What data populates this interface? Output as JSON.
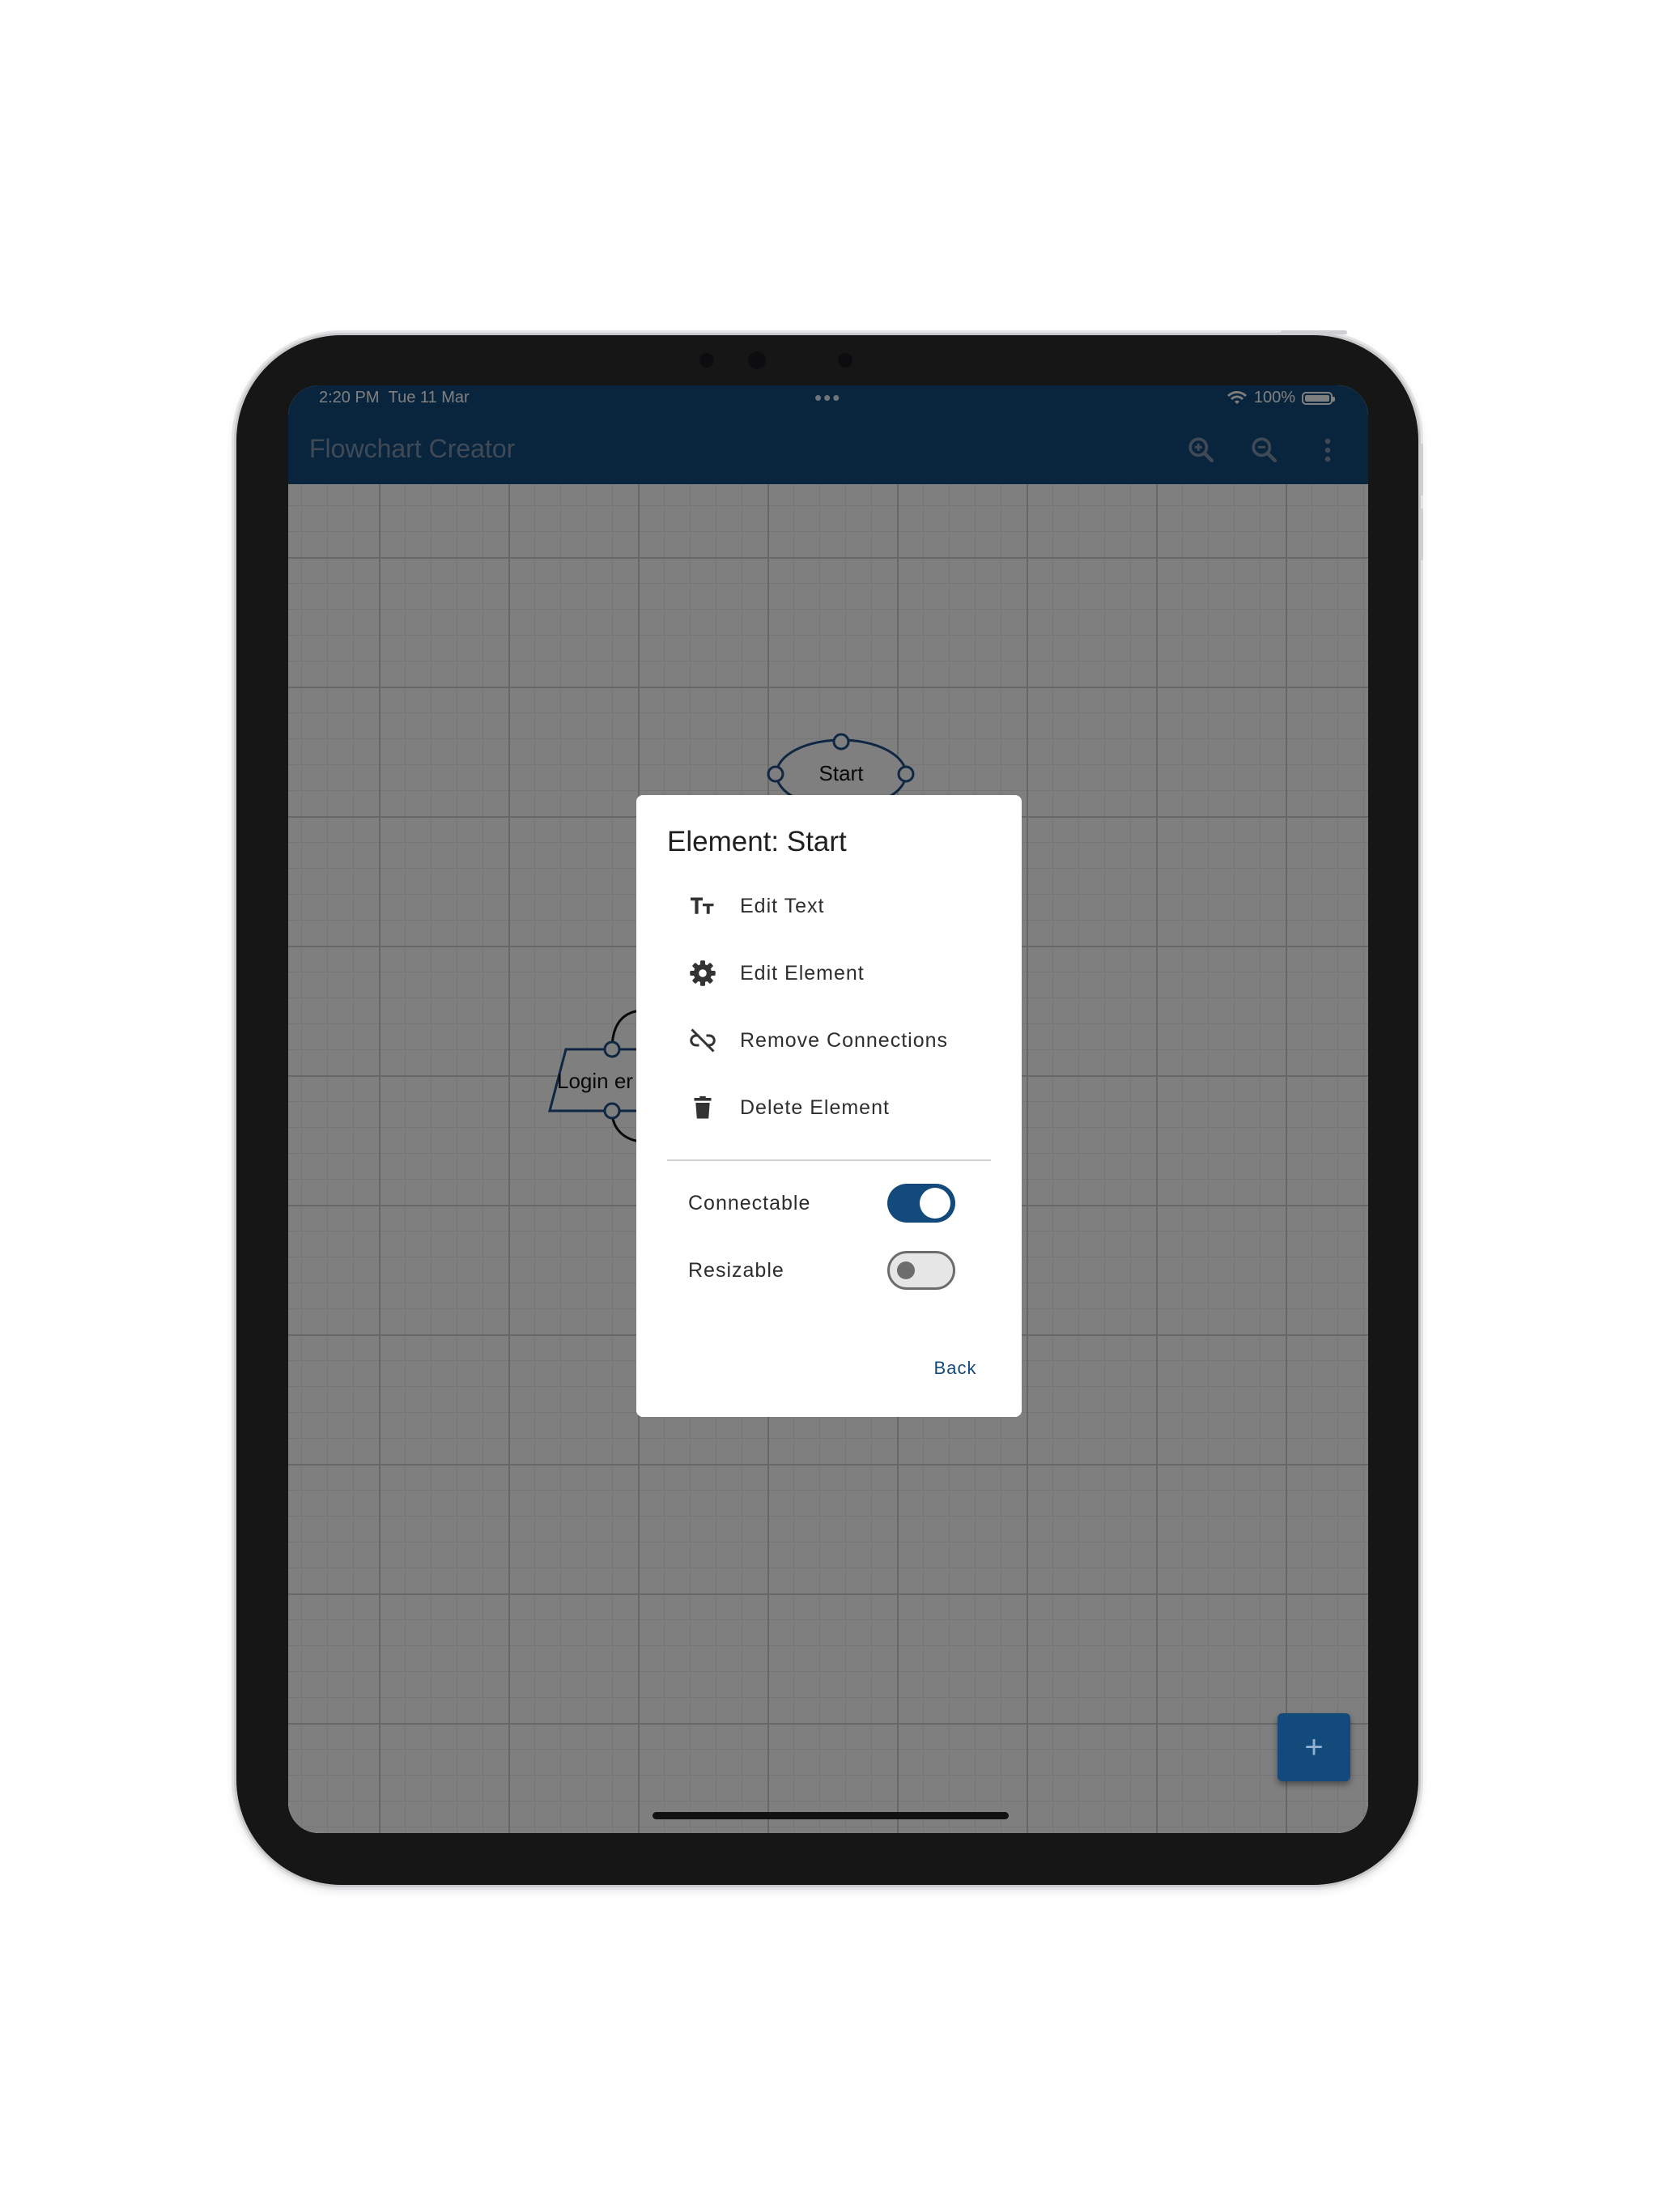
{
  "status_bar": {
    "time": "2:20 PM",
    "date": "Tue 11 Mar",
    "center_dots": "•••",
    "battery_percent": "100%"
  },
  "app_bar": {
    "title": "Flowchart Creator",
    "icons": [
      "zoom-in-icon",
      "zoom-out-icon",
      "more-vert-icon"
    ]
  },
  "canvas": {
    "shapes": [
      {
        "type": "ellipse",
        "label": "Start"
      },
      {
        "type": "parallelogram",
        "label": "Login er"
      }
    ]
  },
  "dialog": {
    "title": "Element: Start",
    "menu_items": [
      {
        "label": "Edit Text",
        "icon": "text-format-icon"
      },
      {
        "label": "Edit Element",
        "icon": "gear-icon"
      },
      {
        "label": "Remove Connections",
        "icon": "link-off-icon"
      },
      {
        "label": "Delete Element",
        "icon": "trash-icon"
      }
    ],
    "toggles": [
      {
        "label": "Connectable",
        "on": true
      },
      {
        "label": "Resizable",
        "on": false
      }
    ],
    "back_label": "Back"
  },
  "fab": {
    "label": "+"
  },
  "colors": {
    "primary": "#134a7c",
    "scrim": "rgba(0,0,0,0.5)",
    "shape_stroke": "#1f4f86"
  }
}
